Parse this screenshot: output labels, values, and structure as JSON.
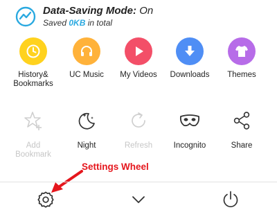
{
  "data_saving": {
    "title": "Data-Saving Mode:",
    "state": "On",
    "saved_prefix": "Saved",
    "saved_amount": "0KB",
    "saved_suffix": "in total"
  },
  "menu_row1": [
    {
      "label": "History& Bookmarks",
      "icon": "clock-icon",
      "color": "#ffd21e"
    },
    {
      "label": "UC Music",
      "icon": "headphones-icon",
      "color": "#ffb23a"
    },
    {
      "label": "My Videos",
      "icon": "play-icon",
      "color": "#f34f68"
    },
    {
      "label": "Downloads",
      "icon": "download-icon",
      "color": "#4f8ef5"
    },
    {
      "label": "Themes",
      "icon": "shirt-icon",
      "color": "#b76ce8"
    }
  ],
  "menu_row2": [
    {
      "label": "Add Bookmark",
      "icon": "star-plus-icon",
      "enabled": false
    },
    {
      "label": "Night",
      "icon": "moon-icon",
      "enabled": true
    },
    {
      "label": "Refresh",
      "icon": "refresh-icon",
      "enabled": false
    },
    {
      "label": "Incognito",
      "icon": "mask-icon",
      "enabled": true
    },
    {
      "label": "Share",
      "icon": "share-icon",
      "enabled": true
    }
  ],
  "annotation": {
    "text": "Settings Wheel",
    "color": "#e5161d"
  },
  "bottom_bar": {
    "settings_icon": "gear-icon",
    "collapse_icon": "chevron-down-icon",
    "exit_icon": "power-icon"
  }
}
